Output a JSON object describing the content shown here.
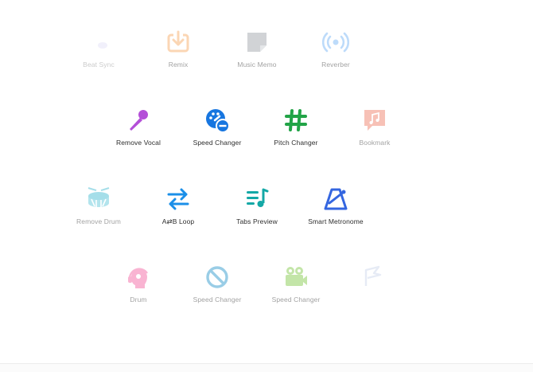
{
  "tiles": [
    {
      "row": 0,
      "col": 0,
      "label": "Beat Sync",
      "name": "beat-sync",
      "icon": "sparkle-icon",
      "color": "#c9c4f2",
      "state": "ghost"
    },
    {
      "row": 0,
      "col": 1,
      "label": "Remix",
      "name": "remix",
      "icon": "download-tray-icon",
      "color": "#f7a55b",
      "state": "faded"
    },
    {
      "row": 0,
      "col": 2,
      "label": "Music Memo",
      "name": "music-memo",
      "icon": "sticky-note-icon",
      "color": "#9aa0a6",
      "state": "faded"
    },
    {
      "row": 0,
      "col": 3,
      "label": "Reverber",
      "name": "reverber",
      "icon": "broadcast-icon",
      "color": "#6fb0f5",
      "state": "faded"
    },
    {
      "row": 1,
      "col": 1,
      "label": "Remove Vocal",
      "name": "remove-vocal",
      "icon": "microphone-icon",
      "color": "#b44fd8",
      "state": "normal"
    },
    {
      "row": 1,
      "col": 2,
      "label": "Speed Changer",
      "name": "speed-changer",
      "icon": "gauge-minus-icon",
      "color": "#1776e0",
      "state": "normal"
    },
    {
      "row": 1,
      "col": 3,
      "label": "Pitch Changer",
      "name": "pitch-changer",
      "icon": "hashtag-icon",
      "color": "#22a447",
      "state": "normal"
    },
    {
      "row": 1,
      "col": 4,
      "label": "Bookmark",
      "name": "bookmark",
      "icon": "music-note-chat-icon",
      "color": "#ee7860",
      "state": "faded"
    },
    {
      "row": 2,
      "col": 0,
      "label": "Remove Drum",
      "name": "remove-drum",
      "icon": "drum-icon",
      "color": "#3ab7cf",
      "state": "faded"
    },
    {
      "row": 2,
      "col": 1,
      "label": "A⇄B Loop",
      "name": "ab-loop",
      "icon": "swap-arrows-icon",
      "color": "#1b8fe8",
      "state": "normal"
    },
    {
      "row": 2,
      "col": 2,
      "label": "Tabs Preview",
      "name": "tabs-preview",
      "icon": "playlist-icon",
      "color": "#14a8a6",
      "state": "normal"
    },
    {
      "row": 2,
      "col": 3,
      "label": "Smart Metronome",
      "name": "smart-metronome",
      "icon": "metronome-icon",
      "color": "#3466e0",
      "state": "normal"
    },
    {
      "row": 3,
      "col": 0,
      "label": "Drum",
      "name": "drum-headphones",
      "icon": "head-headphones-icon",
      "color": "#f25a9c",
      "state": "faded"
    },
    {
      "row": 3,
      "col": 1,
      "label": "Speed Changer",
      "name": "speed-changer-2",
      "icon": "block-icon",
      "color": "#1f91c9",
      "state": "faded"
    },
    {
      "row": 3,
      "col": 2,
      "label": "Speed Changer",
      "name": "speed-changer-3",
      "icon": "video-camera-icon",
      "color": "#7cc63f",
      "state": "faded"
    },
    {
      "row": 3,
      "col": 3,
      "label": "",
      "name": "unknown-tile",
      "icon": "flag-icon",
      "color": "#9fb2d8",
      "state": "ghost"
    }
  ]
}
